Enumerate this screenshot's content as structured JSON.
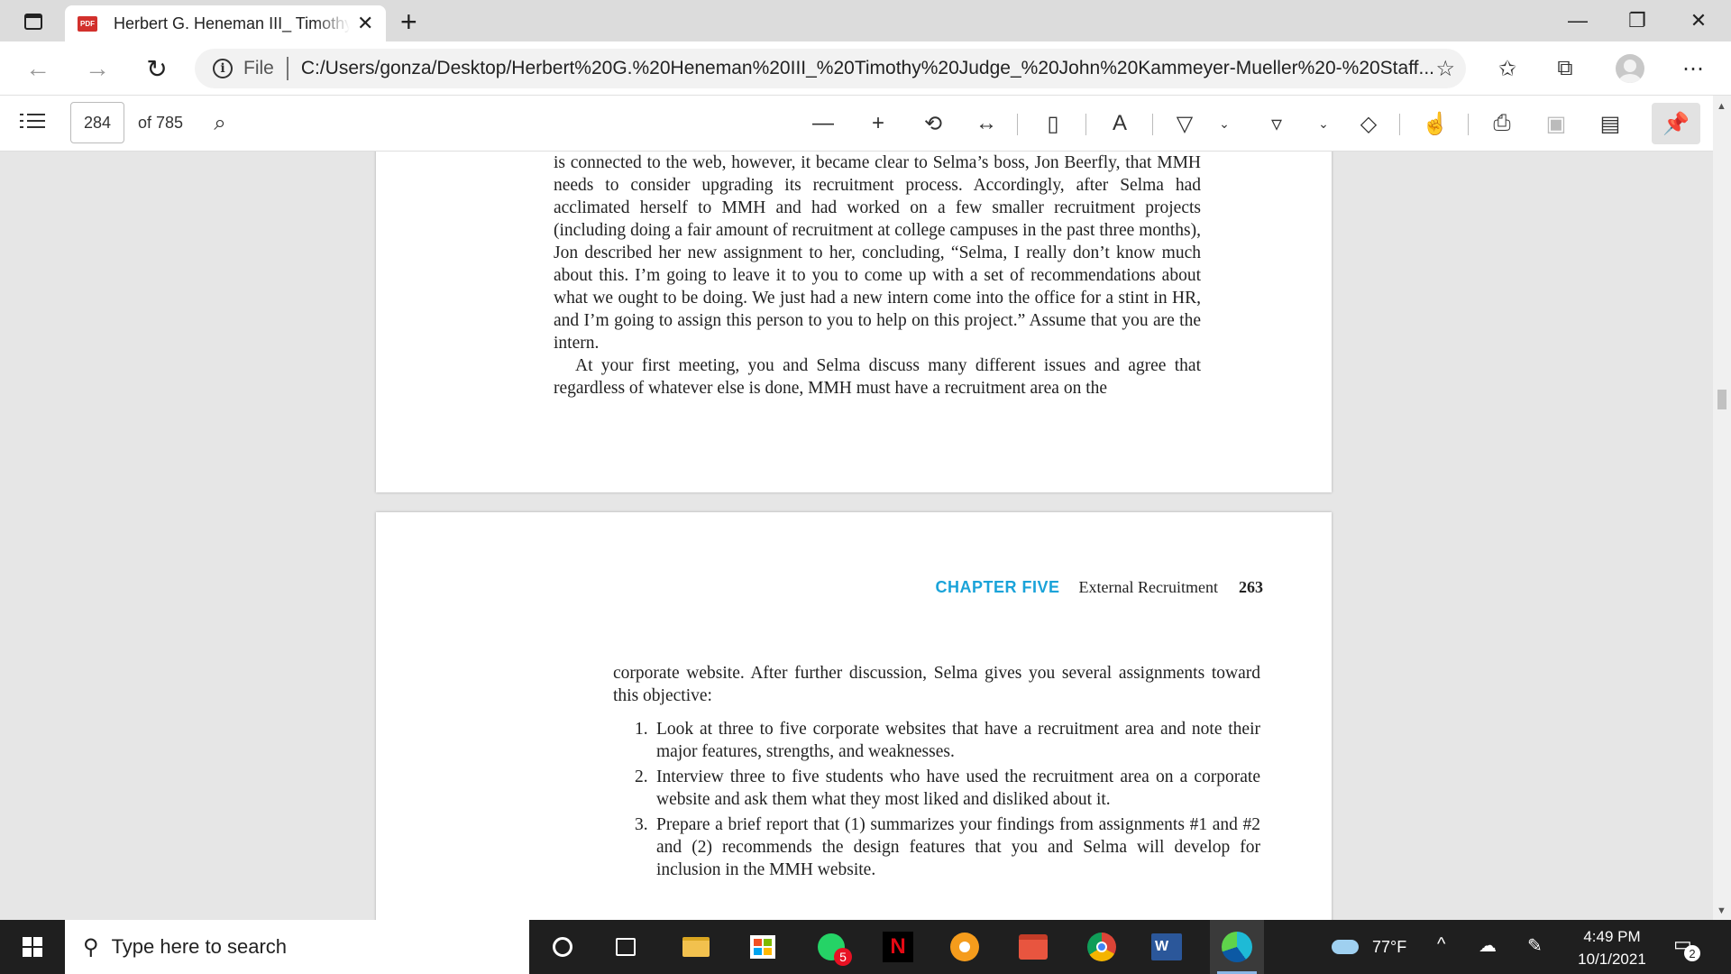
{
  "browser": {
    "tab_title": "Herbert G. Heneman III_ Timothy Judge_ John Kammeyer-Mueller - Staffing Organizations",
    "tab_icon_label": "PDF",
    "address_label": "File",
    "url": "C:/Users/gonza/Desktop/Herbert%20G.%20Heneman%20III_%20Timothy%20Judge_%20John%20Kammeyer-Mueller%20-%20Staff..."
  },
  "pdf_toolbar": {
    "page_number": "284",
    "page_total": "of 785"
  },
  "document": {
    "page1_paragraphs": [
      "is connected to the web, however, it became clear to Selma’s boss, Jon Beerfly, that MMH needs to consider upgrading its recruitment process. Accordingly, after Selma had acclimated herself to MMH and had worked on a few smaller recruitment projects (including doing a fair amount of recruitment at college campuses in the past three months), Jon described her new assignment to her, concluding, “Selma, I really don’t know much about this. I’m going to leave it to you to come up with a set of recommendations about what we ought to be doing. We just had a new intern come into the office for a stint in HR, and I’m going to assign this person to you to help on this project.” Assume that you are the intern.",
      "At your first meeting, you and Selma discuss many different issues and agree that regardless of whatever else is done, MMH must have a recruitment area on the"
    ],
    "running_head": {
      "chapter": "CHAPTER FIVE",
      "title": "External Recruitment",
      "page": "263"
    },
    "page2_intro": "corporate website. After further discussion, Selma gives you several assignments toward this objective:",
    "assignments": [
      {
        "num": "1.",
        "text": "Look at three to five corporate websites that have a recruitment area and note their major features, strengths, and weaknesses."
      },
      {
        "num": "2.",
        "text": "Interview three to five students who have used the recruitment area on a corporate website and ask them what they most liked and disliked about it."
      },
      {
        "num": "3.",
        "text": "Prepare a brief report that (1) summarizes your findings from assignments #1 and #2 and (2) recommends the design features that you and Selma will develop for inclusion in the MMH website."
      }
    ]
  },
  "taskbar": {
    "search_placeholder": "Type here to search",
    "whatsapp_badge": "5",
    "netflix_letter": "N",
    "word_letter": "W",
    "weather": "77°F",
    "time": "4:49 PM",
    "date": "10/1/2021",
    "notification_count": "2"
  },
  "colors": {
    "chapter_accent": "#1aa3d9",
    "taskbar": "#1f1f1f"
  }
}
